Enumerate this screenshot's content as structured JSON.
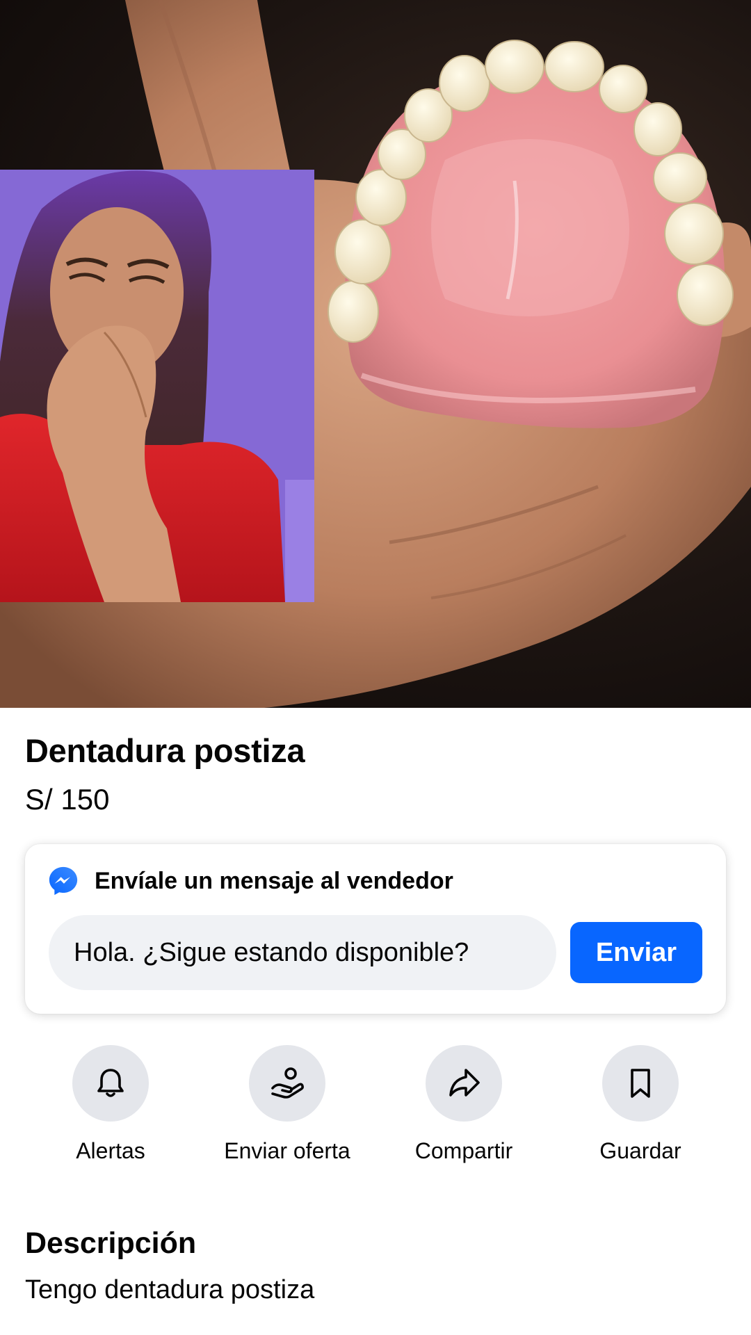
{
  "listing": {
    "title": "Dentadura postiza",
    "price": "S/ 150"
  },
  "message_card": {
    "heading": "Envíale un mensaje al vendedor",
    "input_value": "Hola. ¿Sigue estando disponible?",
    "send_label": "Enviar",
    "icon": "messenger-icon"
  },
  "actions": [
    {
      "label": "Alertas",
      "icon": "bell-icon"
    },
    {
      "label": "Enviar oferta",
      "icon": "offer-icon"
    },
    {
      "label": "Compartir",
      "icon": "share-icon"
    },
    {
      "label": "Guardar",
      "icon": "bookmark-icon"
    }
  ],
  "description": {
    "heading": "Descripción",
    "text": "Tengo dentadura postiza"
  },
  "colors": {
    "accent": "#0866ff",
    "action_circle": "#e4e6eb",
    "input_bg": "#f0f2f5"
  }
}
